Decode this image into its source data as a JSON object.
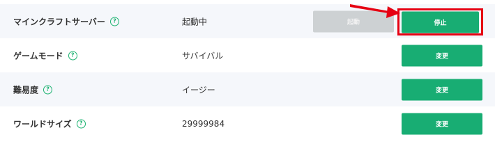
{
  "settings": [
    {
      "label": "マインクラフトサーバー",
      "help_icon": "?",
      "value": "起動中",
      "secondary_button_label": "起動",
      "primary_button_label": "停止"
    },
    {
      "label": "ゲームモード",
      "help_icon": "?",
      "value": "サバイバル",
      "primary_button_label": "変更"
    },
    {
      "label": "難易度",
      "help_icon": "?",
      "value": "イージー",
      "primary_button_label": "変更"
    },
    {
      "label": "ワールドサイズ",
      "help_icon": "?",
      "value": "29999984",
      "primary_button_label": "変更"
    }
  ],
  "colors": {
    "accent_green": "#18ad73",
    "disabled_gray": "#cdd1d3",
    "highlight_red": "#e60012",
    "row_alt_bg": "#f5f7fb"
  },
  "icons": {
    "help": "help-circle-icon",
    "annotation": "red-arrow-annotation"
  }
}
